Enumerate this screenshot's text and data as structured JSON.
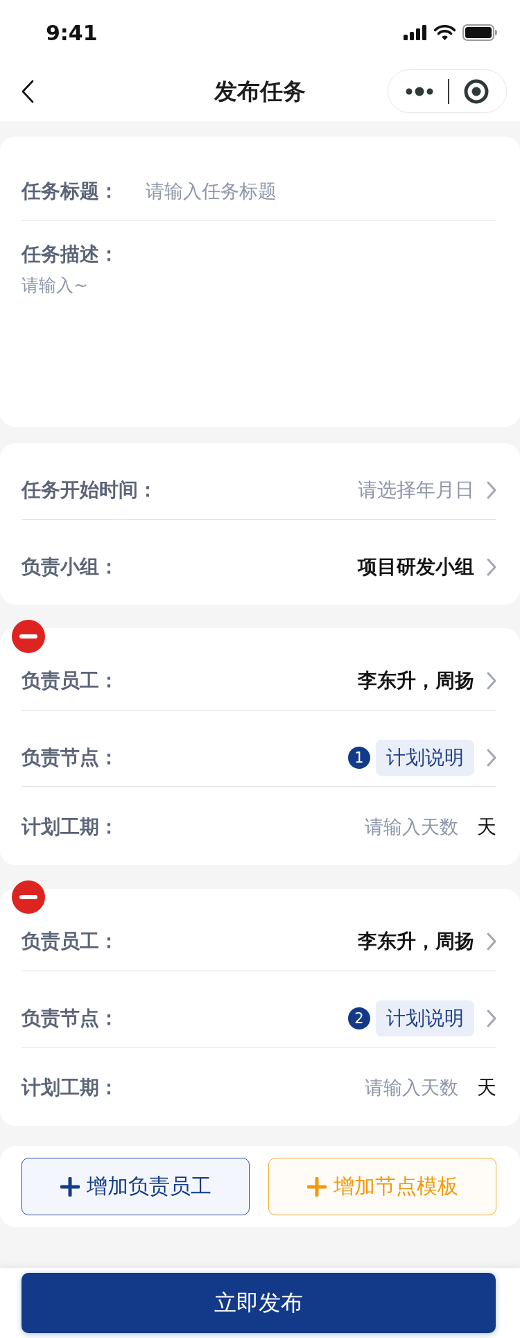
{
  "status_bar": {
    "time": "9:41"
  },
  "nav_bar": {
    "title": "发布任务"
  },
  "task_card": {
    "fields": [
      {
        "kind": "input",
        "label": "任务标题：",
        "placeholder": "请输入任务标题"
      },
      {
        "kind": "textarea",
        "label": "任务描述：",
        "placeholder": "请输入~"
      }
    ]
  },
  "setup_card": {
    "fields": [
      {
        "kind": "picker",
        "label": "任务开始时间：",
        "placeholder": "请选择年月日"
      },
      {
        "kind": "picker",
        "label": "负责小组：",
        "value": "项目研发小组"
      }
    ]
  },
  "assignments": [
    {
      "fields": [
        {
          "kind": "picker",
          "label": "负责员工：",
          "value": "李东升，周扬"
        },
        {
          "kind": "node",
          "label": "负责节点：",
          "number": "1",
          "tag": "计划说明"
        },
        {
          "kind": "days",
          "label": "计划工期：",
          "placeholder": "请输入天数",
          "unit": "天"
        }
      ]
    },
    {
      "fields": [
        {
          "kind": "picker",
          "label": "负责员工：",
          "value": "李东升，周扬"
        },
        {
          "kind": "node",
          "label": "负责节点：",
          "number": "2",
          "tag": "计划说明"
        },
        {
          "kind": "days",
          "label": "计划工期：",
          "placeholder": "请输入天数",
          "unit": "天"
        }
      ]
    }
  ],
  "actions": [
    {
      "kind": "primary",
      "label": "增加负责员工"
    },
    {
      "kind": "accent",
      "label": "增加节点模板"
    }
  ],
  "submit": {
    "label": "立即发布"
  }
}
